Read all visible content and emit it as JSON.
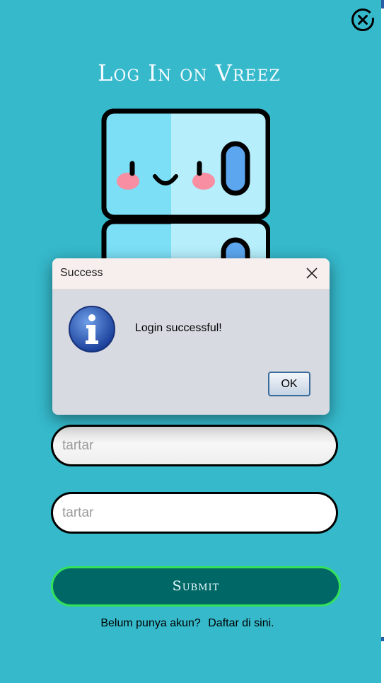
{
  "header": {
    "title": "Log In on Vreez"
  },
  "form": {
    "username": {
      "value": "tartar"
    },
    "password": {
      "value": "tartar"
    },
    "submit_label": "Submit",
    "signup_prompt": "Belum punya akun?",
    "signup_link": "Daftar di sini."
  },
  "dialog": {
    "title": "Success",
    "message": "Login successful!",
    "ok_label": "OK"
  },
  "colors": {
    "background": "#35b9cb",
    "submit_bg": "#006767",
    "submit_border": "#33e15a",
    "dialog_bg": "#d7dae1"
  },
  "icons": {
    "window_close": "circle-x-icon",
    "dialog_close": "close-icon",
    "dialog_info": "info-icon",
    "mascot": "mascot-logo"
  }
}
